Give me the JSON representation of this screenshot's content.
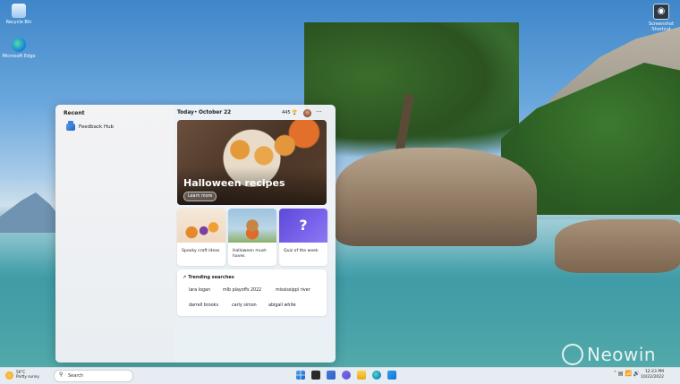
{
  "desktop": {
    "icons": [
      {
        "label": "Recycle Bin"
      },
      {
        "label": "Microsoft Edge"
      },
      {
        "label": "Screenshot Shortcut"
      }
    ]
  },
  "widgets": {
    "recent_title": "Recent",
    "recent_items": [
      {
        "label": "Feedback Hub",
        "icon": "feedback-hub-icon"
      }
    ],
    "today_label": "Today",
    "date_label": "October 22",
    "rewards_points": "445",
    "hero": {
      "title": "Halloween recipes",
      "button": "Learn more"
    },
    "cards": [
      {
        "caption": "Spooky craft ideas"
      },
      {
        "caption": "Halloween must-haves"
      },
      {
        "caption": "Quiz of the week"
      }
    ],
    "trending": {
      "title": "Trending searches",
      "items": [
        "lara logan",
        "mlb playoffs 2022",
        "mississippi river",
        "darrell brooks",
        "carly simon",
        "abigail white"
      ]
    }
  },
  "taskbar": {
    "weather_temp": "56°C",
    "weather_desc": "Partly sunny",
    "search_placeholder": "Search",
    "clock_time": "12:23 PM",
    "clock_date": "10/22/2022"
  },
  "watermark": {
    "text": "Neowin"
  }
}
